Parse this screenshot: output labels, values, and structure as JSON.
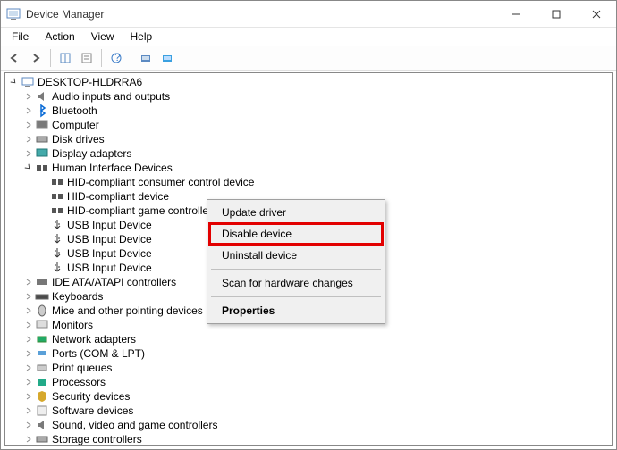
{
  "title": "Device Manager",
  "menu": {
    "file": "File",
    "action": "Action",
    "view": "View",
    "help": "Help"
  },
  "root": "DESKTOP-HLDRRA6",
  "nodes": {
    "audio": "Audio inputs and outputs",
    "bluetooth": "Bluetooth",
    "computer": "Computer",
    "disk": "Disk drives",
    "display": "Display adapters",
    "hid": "Human Interface Devices",
    "hid1": "HID-compliant consumer control device",
    "hid2": "HID-compliant device",
    "hid3": "HID-compliant game controller",
    "usb1": "USB Input Device",
    "usb2": "USB Input Device",
    "usb3": "USB Input Device",
    "usb4": "USB Input Device",
    "ide": "IDE ATA/ATAPI controllers",
    "keyboards": "Keyboards",
    "mice": "Mice and other pointing devices",
    "monitors": "Monitors",
    "network": "Network adapters",
    "ports": "Ports (COM & LPT)",
    "printq": "Print queues",
    "processors": "Processors",
    "security": "Security devices",
    "software": "Software devices",
    "sound": "Sound, video and game controllers",
    "storage": "Storage controllers"
  },
  "context": {
    "update": "Update driver",
    "disable": "Disable device",
    "uninstall": "Uninstall device",
    "scan": "Scan for hardware changes",
    "properties": "Properties"
  }
}
